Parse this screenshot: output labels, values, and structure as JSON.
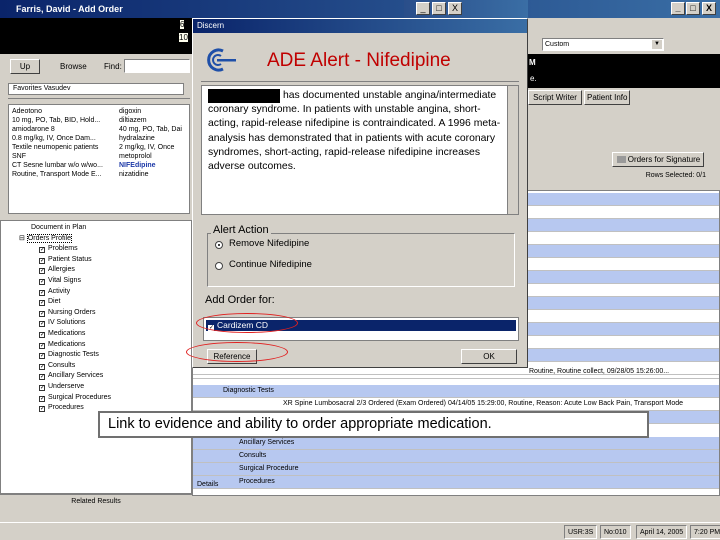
{
  "main_window": {
    "title": "Farris, David - Add Order",
    "minimize": "_",
    "maximize": "□",
    "close": "X"
  },
  "toolbar": {
    "up_label": "Up",
    "browse_label": "Browse",
    "find_label": "Find:",
    "custom_select": "Custom",
    "favorites_tab": "Favorites Vasudev"
  },
  "fragments": {
    "frag1": "6",
    "frag2": "10",
    "frag3": "M",
    "frag4": "e."
  },
  "right_tabs": {
    "script_writer": "Script Writer",
    "patient_info": "Patient Info"
  },
  "orders_for_signature": "Orders for Signature",
  "rows_selected": "Rows Selected: 0/1",
  "med_list_left": [
    "Adeotono",
    "10 mg, PO, Tab, BID, Hold...",
    "amiodarone 8",
    "0.8 mg/kg, IV, Once Dam...",
    "Textile neumopenic patients",
    "SNF",
    "CT Sesne lumbar w/o w/wo...",
    "Routine, Transport Mode E..."
  ],
  "med_list_right": [
    "digoxin",
    "diltiazem",
    "40 mg, PO, Tab, Dai",
    "hydralazine",
    "2 mg/kg, IV, Once",
    "metoprolol",
    "NIFEdipine",
    "nizatidine"
  ],
  "tree": {
    "nodes": [
      "Document in Plan",
      "Orders Profile",
      "Problems",
      "Patient Status",
      "Allergies",
      "Vital Signs",
      "Activity",
      "Diet",
      "Nursing Orders",
      "IV Solutions",
      "Medications",
      "Medications",
      "Diagnostic Tests",
      "Consults",
      "Ancillary Services",
      "Underserve",
      "Surgical Procedures",
      "Procedures"
    ],
    "related_results": "Related Results",
    "details_label": "Details"
  },
  "grid": {
    "routine_row": "Routine, Routine collect, 09/28/05 15:26:00...",
    "diagnostic_tests": "Diagnostic Tests",
    "xr_row": "XR Spine Lumbosacral 2/3    Ordered (Exam Ordered)    04/14/05 15:29:00, Routine, Reason: Acute Low Back Pain, Transport Mode",
    "categories": [
      "Ancillary Services",
      "Consults",
      "Surgical Procedure",
      "Procedures"
    ]
  },
  "status_bar": {
    "user": "USR:3S",
    "mode": "No:010",
    "date": "April 14, 2005",
    "time": "7:20 PM"
  },
  "dialog": {
    "title": "Discern",
    "alert_title": "ADE Alert - Nifedipine",
    "message": "has documented unstable angina/intermediate coronary syndrome. In patients with unstable angina, short-acting, rapid-release nifedipine is contraindicated. A 1996 meta-analysis has demonstrated that in patients with acute coronary syndromes, short-acting, rapid-release nifedipine increases adverse outcomes.",
    "alert_action": "Alert Action",
    "remove_label": "Remove Nifedipine",
    "continue_label": "Continue Nifedipine",
    "add_order_for": "Add Order for:",
    "order_item": "Cardizem CD",
    "reference_button": "Reference",
    "ok_button": "OK"
  },
  "callout": "Link to evidence and ability to order appropriate medication.",
  "colors": {
    "title_bar": "#0a246a",
    "alert_red": "#c00000",
    "grid_blue": "#b7c8f0",
    "annotation_red": "#e02020"
  }
}
